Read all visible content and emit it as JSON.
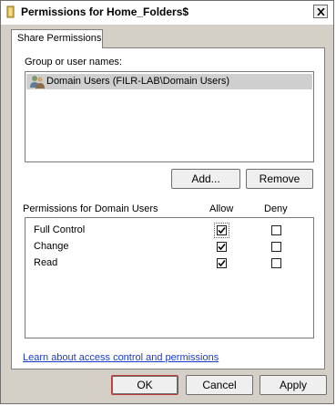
{
  "window": {
    "title": "Permissions for Home_Folders$"
  },
  "tab": {
    "label": "Share Permissions"
  },
  "users": {
    "heading": "Group or user names:",
    "items": [
      {
        "label": "Domain Users (FILR-LAB\\Domain Users)",
        "icon": "users-group-icon",
        "selected": true
      }
    ]
  },
  "buttons": {
    "add": "Add...",
    "remove": "Remove",
    "ok": "OK",
    "cancel": "Cancel",
    "apply": "Apply"
  },
  "permissions": {
    "heading": "Permissions for Domain Users",
    "allow_header": "Allow",
    "deny_header": "Deny",
    "rows": [
      {
        "name": "Full Control",
        "allow": true,
        "deny": false
      },
      {
        "name": "Change",
        "allow": true,
        "deny": false
      },
      {
        "name": "Read",
        "allow": true,
        "deny": false
      }
    ]
  },
  "help_link": "Learn about access control and permissions"
}
